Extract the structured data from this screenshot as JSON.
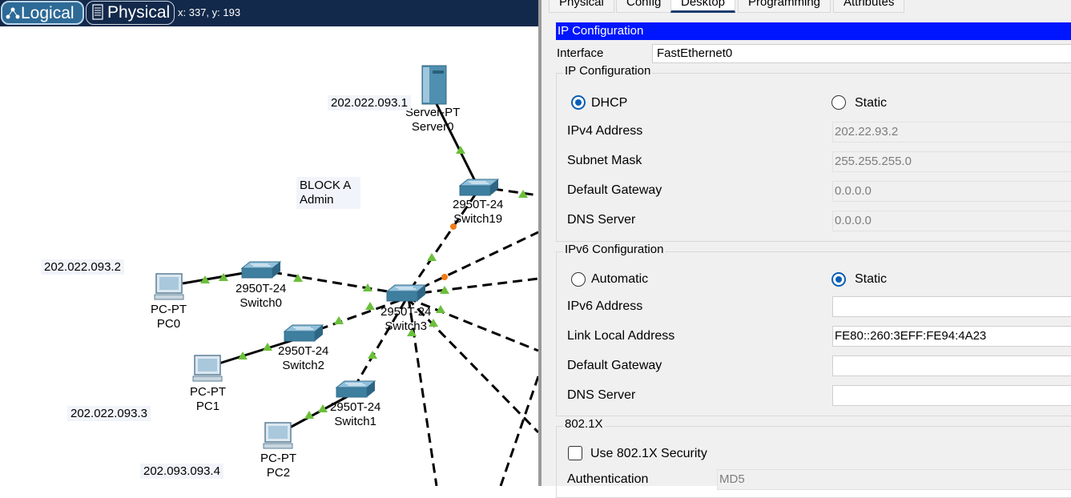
{
  "topology": {
    "mode_buttons": {
      "logical": "Logical",
      "physical": "Physical"
    },
    "coords": "x: 337, y: 193",
    "devices": {
      "server0": {
        "type": "Server-PT",
        "name": "Server0"
      },
      "switch19": {
        "type": "2950T-24",
        "name": "Switch19"
      },
      "switch0": {
        "type": "2950T-24",
        "name": "Switch0"
      },
      "switch3": {
        "type": "2950T-24",
        "name": "Switch3"
      },
      "switch2": {
        "type": "2950T-24",
        "name": "Switch2"
      },
      "switch1": {
        "type": "2950T-24",
        "name": "Switch1"
      },
      "pc0": {
        "type": "PC-PT",
        "name": "PC0"
      },
      "pc1": {
        "type": "PC-PT",
        "name": "PC1"
      },
      "pc2": {
        "type": "PC-PT",
        "name": "PC2"
      }
    },
    "notes": {
      "server_ip": "202.022.093.1",
      "block_line1": "BLOCK A",
      "block_line2": "Admin",
      "pc0_ip": "202.022.093.2",
      "pc1_ip": "202.022.093.3",
      "pc2_ip": "202.093.093.4"
    },
    "colors": {
      "link_up": "#6cbf3b",
      "link_pending": "#f07c1a",
      "topbar": "#13294b"
    }
  },
  "panel": {
    "tabs": [
      "Physical",
      "Config",
      "Desktop",
      "Programming",
      "Attributes"
    ],
    "active_tab": "Desktop",
    "title": "IP Configuration",
    "interface_label": "Interface",
    "interface_value": "FastEthernet0",
    "ipv4": {
      "group_title": "IP Configuration",
      "dhcp_label": "DHCP",
      "static_label": "Static",
      "selected": "DHCP",
      "ipv4_address_label": "IPv4 Address",
      "ipv4_address": "202.22.93.2",
      "subnet_mask_label": "Subnet Mask",
      "subnet_mask": "255.255.255.0",
      "gateway_label": "Default Gateway",
      "gateway": "0.0.0.0",
      "dns_label": "DNS Server",
      "dns": "0.0.0.0"
    },
    "ipv6": {
      "group_title": "IPv6 Configuration",
      "automatic_label": "Automatic",
      "static_label": "Static",
      "selected": "Static",
      "ipv6_address_label": "IPv6 Address",
      "ipv6_address": "",
      "link_local_label": "Link Local Address",
      "link_local": "FE80::260:3EFF:FE94:4A23",
      "gateway_label": "Default Gateway",
      "gateway": "",
      "dns_label": "DNS Server",
      "dns": ""
    },
    "dot1x": {
      "group_title": "802.1X",
      "use_label": "Use 802.1X Security",
      "use_checked": false,
      "auth_label": "Authentication",
      "auth_value": "MD5"
    }
  }
}
